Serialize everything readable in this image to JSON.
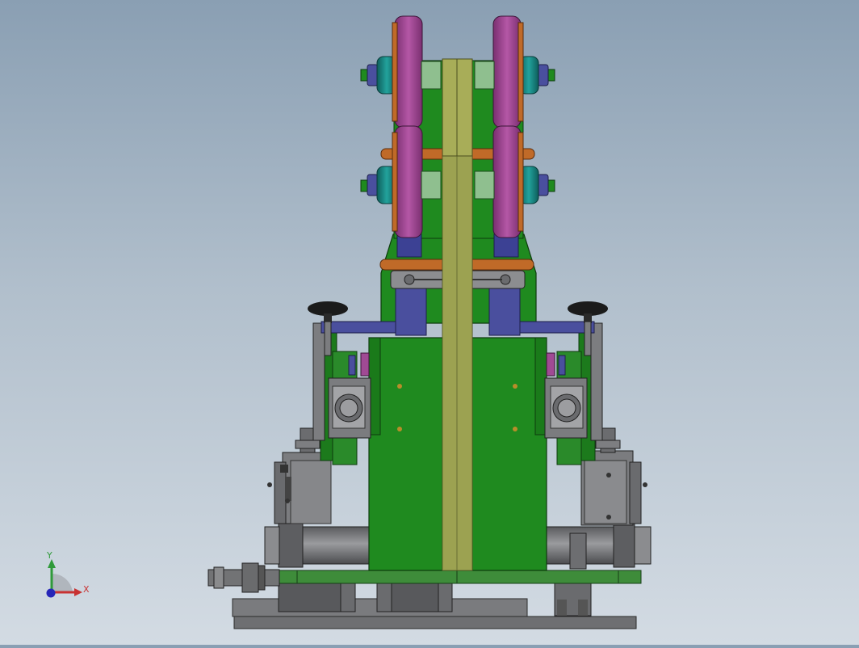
{
  "viewport": {
    "background_top": "#8a9fb3",
    "background_bottom": "#d3dbe3"
  },
  "model": {
    "view": "front",
    "part_colors": {
      "body_green": "#1f8a1f",
      "wheel_magenta": "#a04a94",
      "hub_teal": "#167d7a",
      "bracket_blue": "#4a4f9e",
      "pin_orange": "#c06a28",
      "strip_olive": "#a8ad58",
      "gray_part": "#77787a",
      "dark_gray": "#4a4b4d",
      "knob_black": "#1b1b1b"
    }
  },
  "triad": {
    "x_label": "X",
    "y_label": "Y",
    "x_color": "#c83232",
    "y_color": "#2f9a3a",
    "z_color": "#2626b8"
  }
}
